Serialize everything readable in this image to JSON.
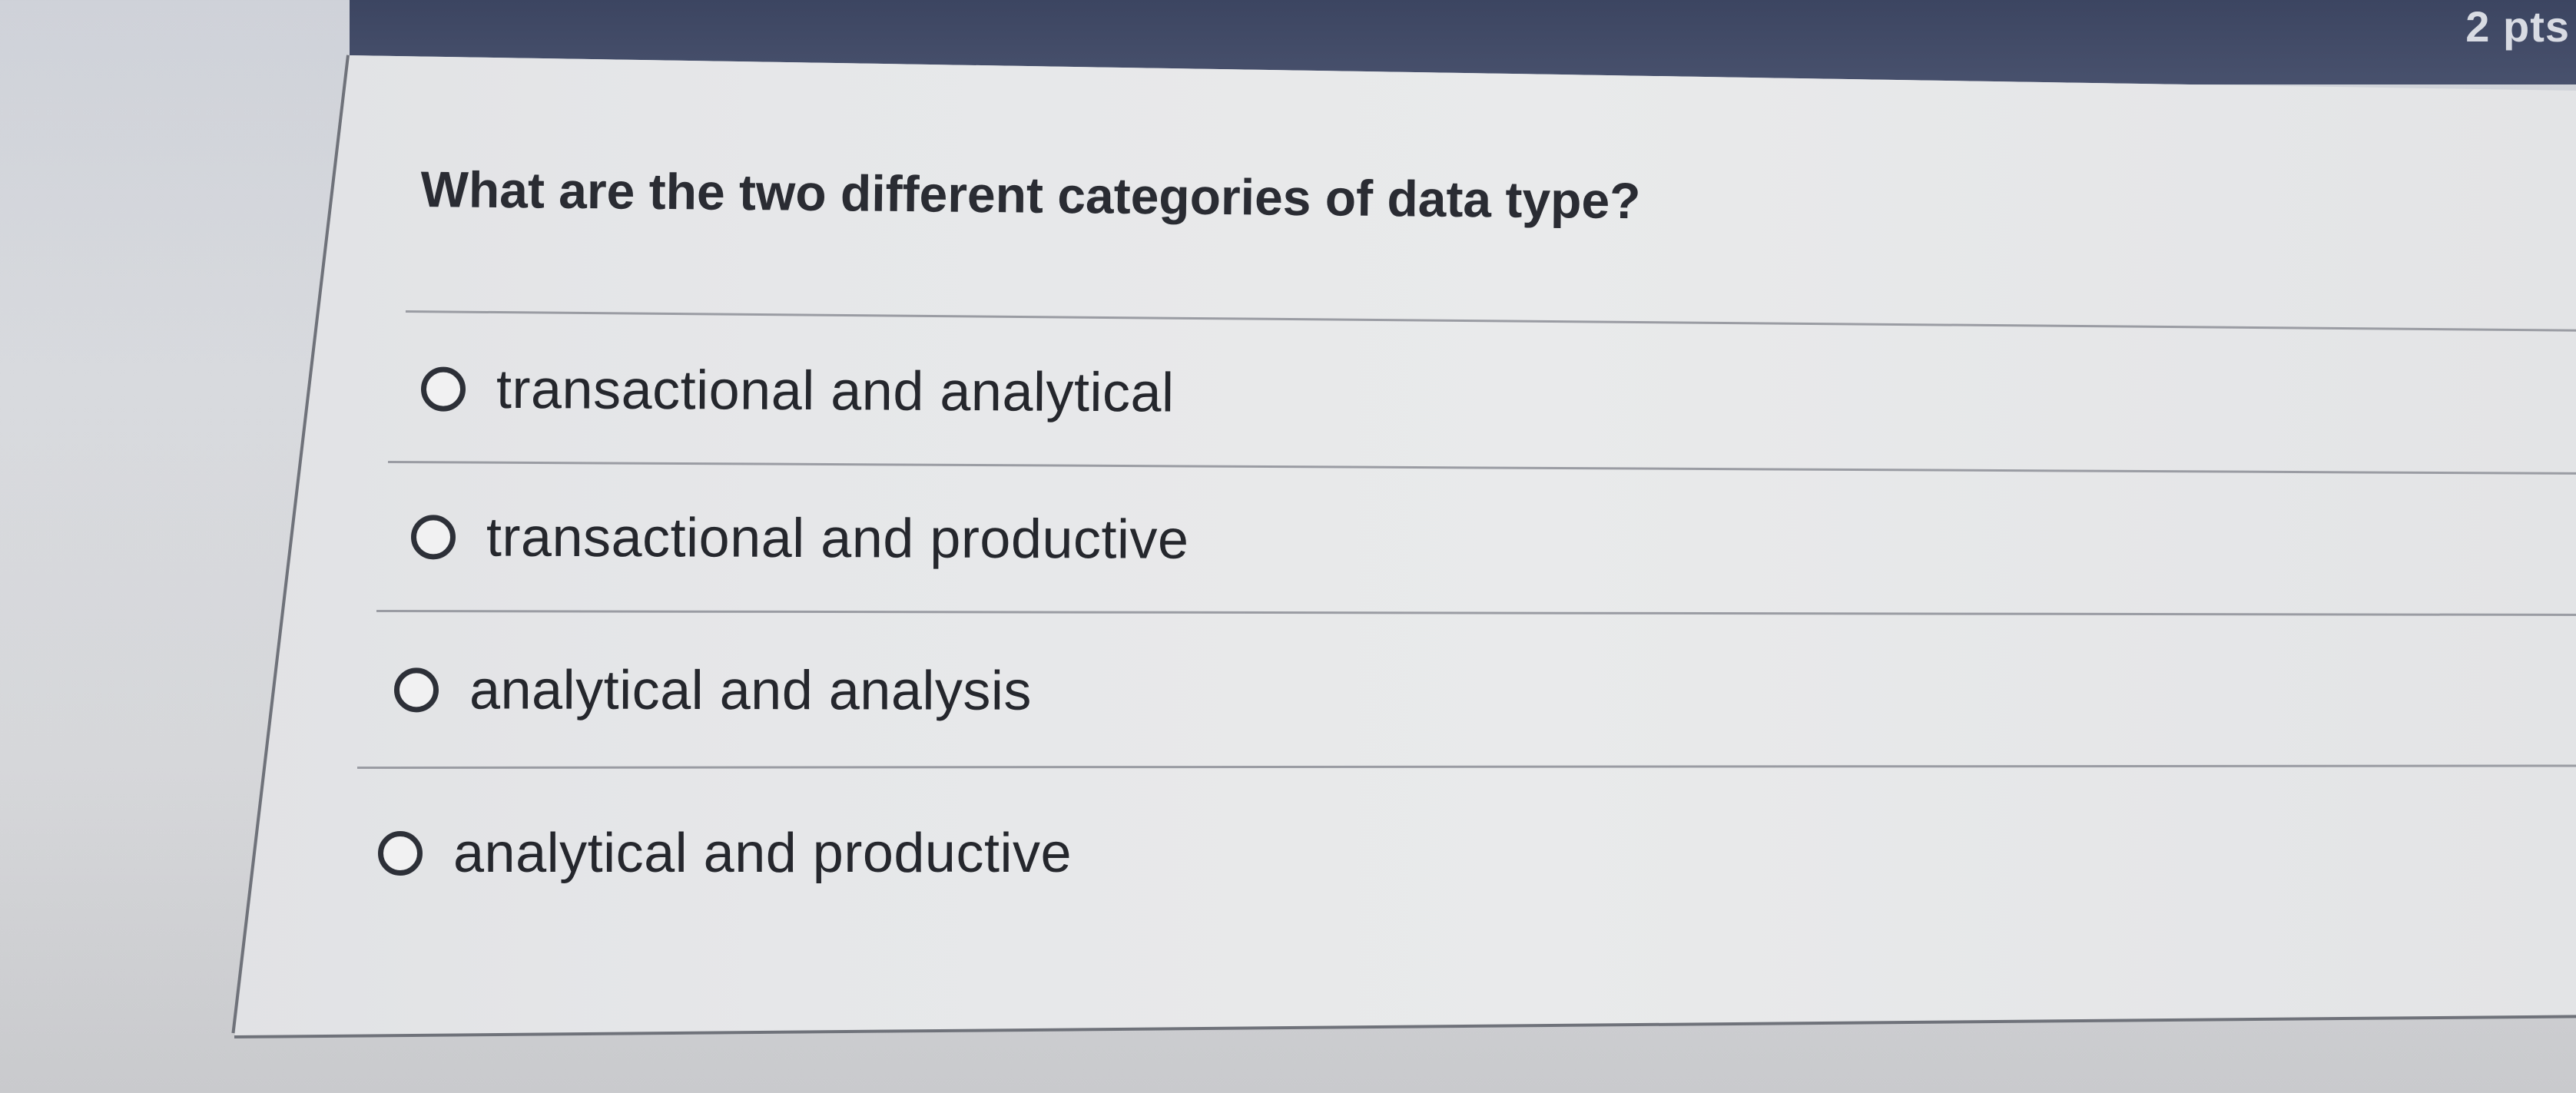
{
  "header": {
    "points": "2 pts"
  },
  "question": {
    "text": "What are the two different categories of data type?"
  },
  "answers": [
    {
      "label": "transactional and analytical",
      "selected": false
    },
    {
      "label": "transactional and productive",
      "selected": false
    },
    {
      "label": "analytical and analysis",
      "selected": false
    },
    {
      "label": "analytical and productive",
      "selected": false
    }
  ]
}
